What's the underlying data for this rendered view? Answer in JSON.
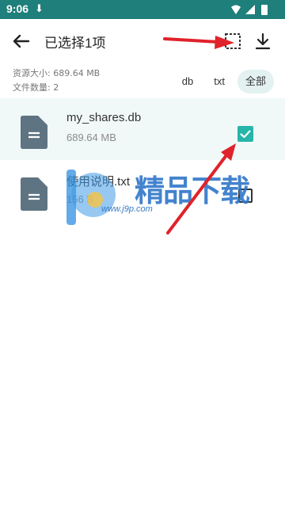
{
  "status_bar": {
    "time": "9:06",
    "download_icon": "download-arrow-icon"
  },
  "header": {
    "title": "已选择1项",
    "back_icon": "arrow-back-icon",
    "select_all_icon": "select-all-icon",
    "download_icon": "download-icon"
  },
  "summary": {
    "size_label": "资源大小: 689.64 MB",
    "count_label": "文件数量: 2"
  },
  "filters": [
    {
      "label": "db",
      "active": false
    },
    {
      "label": "txt",
      "active": false
    },
    {
      "label": "全部",
      "active": true
    }
  ],
  "files": [
    {
      "name": "my_shares.db",
      "size": "689.64 MB",
      "checked": true
    },
    {
      "name": "使用说明.txt",
      "size": "156 B",
      "checked": false
    }
  ],
  "watermark": {
    "text": "精品下载",
    "url": "www.j9p.com"
  },
  "colors": {
    "accent": "#26b5a8",
    "status_bar": "#1f7f7a",
    "selected_row": "#f1f8f8",
    "annotation_arrow": "#e0222a"
  }
}
